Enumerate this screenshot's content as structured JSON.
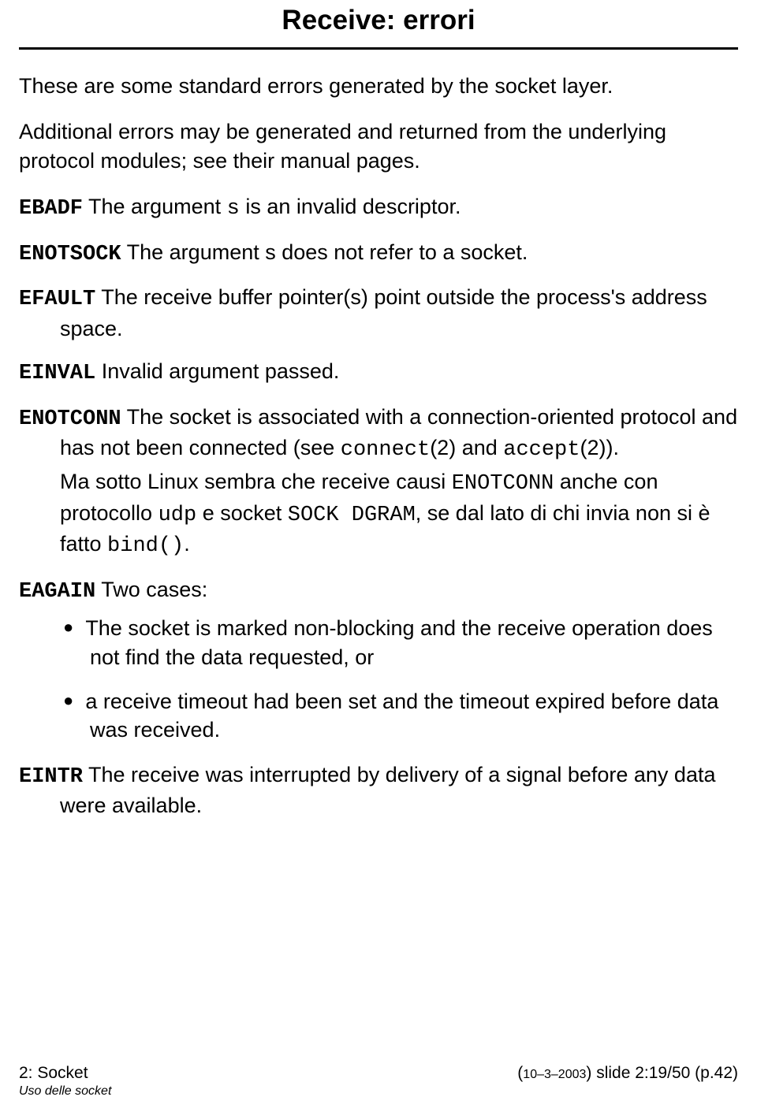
{
  "title": "Receive: errori",
  "intro1": "These are some standard errors generated by the socket layer.",
  "intro2": "Additional errors may be generated and returned from the underlying protocol modules; see their manual pages.",
  "errors": {
    "ebadf": {
      "term": "EBADF",
      "pre": " The argument ",
      "arg": "s",
      "post": " is an invalid descriptor."
    },
    "enotsock": {
      "term": "ENOTSOCK",
      "desc": " The argument s does not refer to a socket."
    },
    "efault": {
      "term": "EFAULT",
      "desc": " The receive buffer pointer(s) point outside the process's address space."
    },
    "einval": {
      "term": "EINVAL",
      "desc": " Invalid argument passed."
    },
    "enotconn": {
      "term": "ENOTCONN",
      "d1a": " The socket is associated with a connection-oriented protocol and has not been connected (see ",
      "c1": "connect",
      "d1b": "(2) and ",
      "c2": "accept",
      "d1c": "(2)).",
      "note_a": "Ma sotto Linux sembra che receive causi ",
      "note_code1": "ENOTCONN",
      "note_b": " anche con protocollo ",
      "note_code2": "udp",
      "note_c": " e socket ",
      "note_code3": "SOCK DGRAM",
      "note_d": ", se dal lato di chi invia non si è fatto ",
      "note_code4": "bind()",
      "note_e": "."
    },
    "eagain": {
      "term": "EAGAIN",
      "desc": " Two cases:",
      "b1": "The socket is marked non-blocking and the receive operation does not find the data requested, or",
      "b2": "a receive timeout had been set and the timeout expired before data was received."
    },
    "eintr": {
      "term": "EINTR",
      "desc": " The receive was interrupted by delivery of a signal before any data were available."
    }
  },
  "footer": {
    "left": "2: Socket",
    "right_pre": "(",
    "right_small": "10–3–2003",
    "right_post": ") slide 2:19/50 (p.42)",
    "bottom": "Uso delle socket"
  }
}
